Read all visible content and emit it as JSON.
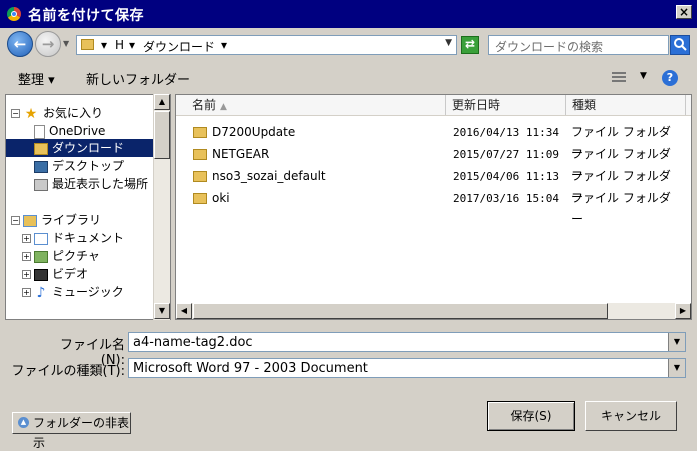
{
  "window": {
    "title": "名前を付けて保存",
    "close_glyph": "×"
  },
  "address": {
    "segments": [
      "H",
      "ダウンロード"
    ],
    "separator": "▾",
    "search_placeholder": "ダウンロードの検索"
  },
  "toolbar": {
    "organize": "整理 ▾",
    "new_folder": "新しいフォルダー"
  },
  "tree": {
    "favorites": {
      "label": "お気に入り",
      "toggle": "⊟"
    },
    "favorites_items": [
      {
        "label": "OneDrive",
        "icon": "cloud-page-icon"
      },
      {
        "label": "ダウンロード",
        "icon": "downloads-folder-icon",
        "selected": true
      },
      {
        "label": "デスクトップ",
        "icon": "desktop-icon"
      },
      {
        "label": "最近表示した場所",
        "icon": "recent-places-icon"
      }
    ],
    "libraries": {
      "label": "ライブラリ",
      "toggle": "⊟"
    },
    "libraries_items": [
      {
        "label": "ドキュメント",
        "icon": "documents-icon",
        "toggle": "⊞"
      },
      {
        "label": "ピクチャ",
        "icon": "pictures-icon",
        "toggle": "⊞"
      },
      {
        "label": "ビデオ",
        "icon": "video-icon",
        "toggle": "⊞"
      },
      {
        "label": "ミュージック",
        "icon": "music-icon",
        "toggle": "⊞"
      }
    ]
  },
  "columns": {
    "name": "名前",
    "date": "更新日時",
    "type": "種類"
  },
  "files": [
    {
      "name": "D7200Update",
      "date": "2016/04/13 11:34",
      "type": "ファイル フォルダー"
    },
    {
      "name": "NETGEAR",
      "date": "2015/07/27 11:09",
      "type": "ファイル フォルダー"
    },
    {
      "name": "nso3_sozai_default",
      "date": "2015/04/06 11:13",
      "type": "ファイル フォルダー"
    },
    {
      "name": "oki",
      "date": "2017/03/16 15:04",
      "type": "ファイル フォルダー"
    }
  ],
  "form": {
    "filename_label": "ファイル名(N):",
    "filename_value": "a4-name-tag2.doc",
    "filetype_label": "ファイルの種類(T):",
    "filetype_value": "Microsoft Word 97 - 2003 Document"
  },
  "buttons": {
    "hide_folders": "フォルダーの非表示",
    "save": "保存(S)",
    "cancel": "キャンセル"
  },
  "colors": {
    "titlebar": "#000080",
    "selection": "#0a246a",
    "dialog_bg": "#d4d0c8"
  }
}
